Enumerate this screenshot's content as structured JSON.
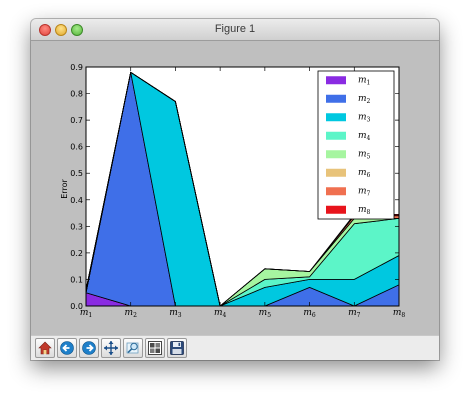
{
  "window": {
    "title": "Figure 1"
  },
  "toolbar": {
    "buttons": [
      {
        "name": "home-button",
        "icon": "home-icon"
      },
      {
        "name": "back-button",
        "icon": "back-arrow-icon"
      },
      {
        "name": "forward-button",
        "icon": "forward-arrow-icon"
      },
      {
        "name": "pan-button",
        "icon": "pan-arrows-icon"
      },
      {
        "name": "zoom-button",
        "icon": "zoom-icon"
      },
      {
        "name": "subplots-button",
        "icon": "subplots-icon"
      },
      {
        "name": "save-button",
        "icon": "floppy-disk-icon"
      }
    ]
  },
  "chart_data": {
    "type": "area",
    "stacked": true,
    "title": "",
    "xlabel": "",
    "ylabel": "Error",
    "ylim": [
      0,
      0.9
    ],
    "yticks": [
      "0.0",
      "0.1",
      "0.2",
      "0.3",
      "0.4",
      "0.5",
      "0.6",
      "0.7",
      "0.8",
      "0.9"
    ],
    "categories": [
      {
        "base": "m",
        "sub": "1"
      },
      {
        "base": "m",
        "sub": "2"
      },
      {
        "base": "m",
        "sub": "3"
      },
      {
        "base": "m",
        "sub": "4"
      },
      {
        "base": "m",
        "sub": "5"
      },
      {
        "base": "m",
        "sub": "6"
      },
      {
        "base": "m",
        "sub": "7"
      },
      {
        "base": "m",
        "sub": "8"
      }
    ],
    "legend_position": "top-right",
    "series": [
      {
        "name": "m",
        "sub": "1",
        "color": "#8a2be2",
        "values": [
          0.05,
          0,
          0,
          0,
          0,
          0,
          0,
          0
        ]
      },
      {
        "name": "m",
        "sub": "2",
        "color": "#3f6fe8",
        "values": [
          0,
          0.88,
          0,
          0,
          0,
          0.07,
          0,
          0.08
        ]
      },
      {
        "name": "m",
        "sub": "3",
        "color": "#00c8e0",
        "values": [
          0,
          0,
          0.77,
          0,
          0.07,
          0.03,
          0.1,
          0.11
        ]
      },
      {
        "name": "m",
        "sub": "4",
        "color": "#5cf5c8",
        "values": [
          0,
          0,
          0,
          0,
          0.03,
          0.01,
          0.21,
          0.14
        ]
      },
      {
        "name": "m",
        "sub": "5",
        "color": "#a6f5a0",
        "values": [
          0.01,
          0,
          0,
          0,
          0.04,
          0.02,
          0.02,
          0
        ]
      },
      {
        "name": "m",
        "sub": "6",
        "color": "#e8c37a",
        "values": [
          0,
          0,
          0,
          0,
          0,
          0,
          0,
          0
        ]
      },
      {
        "name": "m",
        "sub": "7",
        "color": "#f07050",
        "values": [
          0,
          0,
          0,
          0,
          0,
          0,
          0.01,
          0.01
        ]
      },
      {
        "name": "m",
        "sub": "8",
        "color": "#e8141c",
        "values": [
          0,
          0,
          0,
          0,
          0,
          0,
          0.005,
          0.005
        ]
      }
    ]
  }
}
